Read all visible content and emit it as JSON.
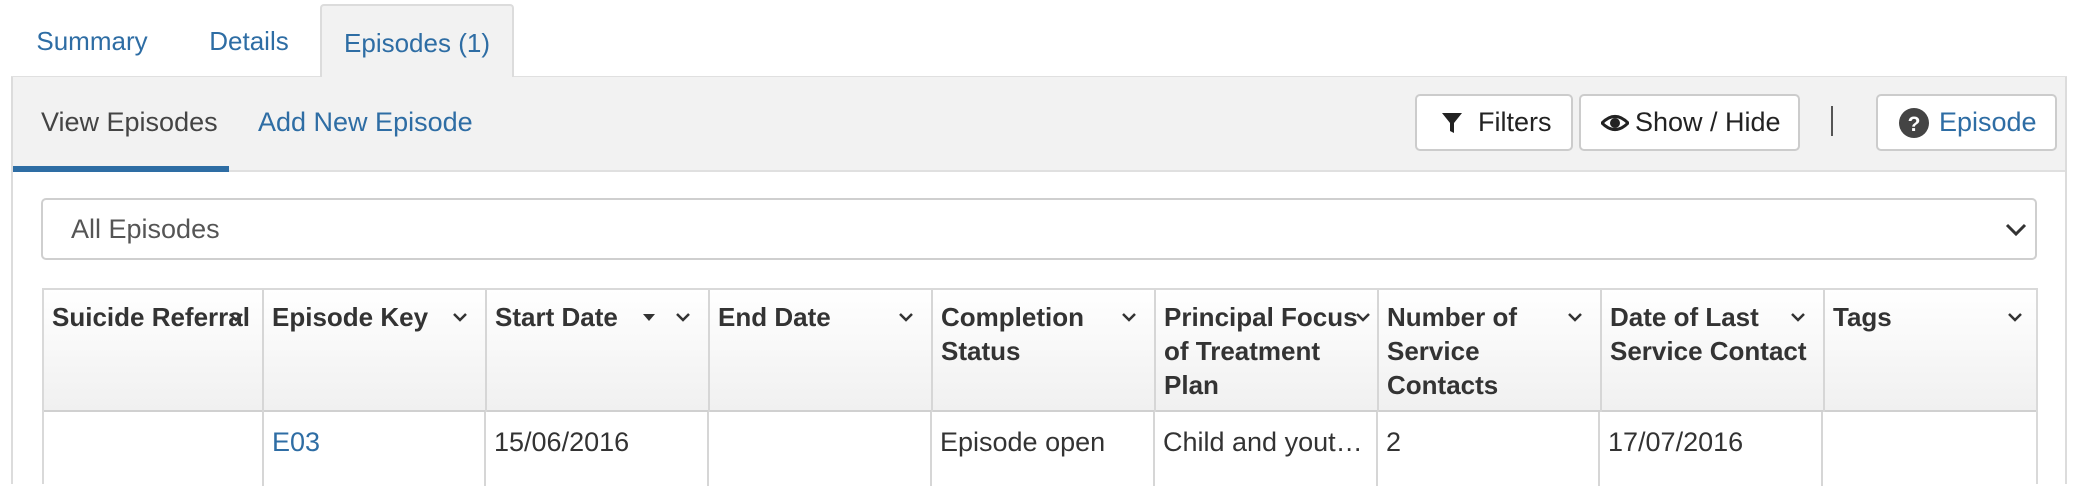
{
  "top_tabs": {
    "summary": "Summary",
    "details": "Details",
    "episodes": "Episodes (1)"
  },
  "sub_tabs": {
    "view": "View Episodes",
    "add": "Add New Episode"
  },
  "toolbar": {
    "filters": "Filters",
    "show_hide": "Show / Hide",
    "help_episode": "Episode",
    "icons": [
      "filter-icon",
      "eye-icon",
      "question-circle-icon"
    ]
  },
  "select": {
    "value": "All Episodes"
  },
  "table": {
    "columns": [
      "Suicide Referral",
      "Episode Key",
      "Start Date",
      "End Date",
      "Completion\nStatus",
      "Principal Focus\nof Treatment\nPlan",
      "Number of\nService\nContacts",
      "Date of Last\nService Contact",
      "Tags"
    ],
    "sorted_column": "Start Date",
    "sort_direction": "descending",
    "rows": [
      [
        "",
        "E03",
        "15/06/2016",
        "",
        "Episode open",
        "Child and youth…",
        "2",
        "17/07/2016",
        ""
      ]
    ]
  },
  "colors": {
    "accent": "#2e6da4",
    "text": "#333333",
    "bar_bg": "#f2f2f2"
  }
}
